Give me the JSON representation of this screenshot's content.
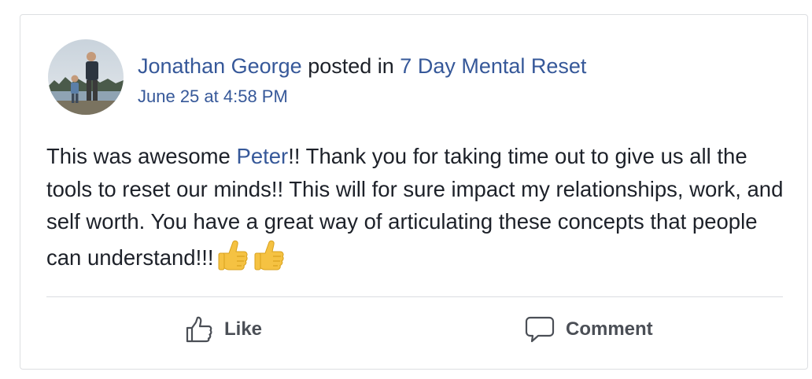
{
  "post": {
    "author": "Jonathan George",
    "action_text": "posted in",
    "group": "7 Day Mental Reset",
    "timestamp": "June 25 at 4:58 PM",
    "body": {
      "part1": "This was awesome ",
      "mention": "Peter",
      "part2": "!! Thank you for taking time out to give us all the tools to reset our minds!! This will for sure impact my relationships, work, and self worth. You have a great way of articulating these concepts that people can understand!!!"
    },
    "emojis": [
      "thumbs-up-icon",
      "thumbs-up-icon"
    ]
  },
  "actions": {
    "like_label": "Like",
    "comment_label": "Comment"
  },
  "colors": {
    "link": "#365899",
    "text": "#1d2129",
    "action_text": "#4b4f56",
    "border": "#dddfe2"
  }
}
